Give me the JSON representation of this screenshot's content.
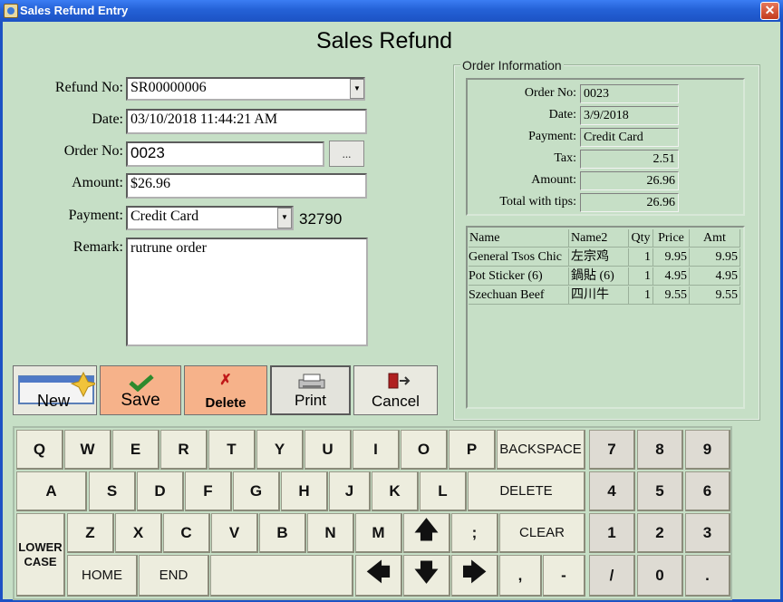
{
  "window": {
    "title": "Sales Refund Entry",
    "close_glyph": "✕"
  },
  "page_title": "Sales Refund",
  "form": {
    "refund_no_label": "Refund No:",
    "refund_no_value": "SR00000006",
    "date_label": "Date:",
    "date_value": "03/10/2018 11:44:21 AM",
    "order_no_label": "Order No:",
    "order_no_value": "0023",
    "order_lookup_label": "...",
    "amount_label": "Amount:",
    "amount_value": "$26.96",
    "payment_label": "Payment:",
    "payment_value": "Credit Card",
    "payment_code": "32790",
    "remark_label": "Remark:",
    "remark_value": "rutrune order",
    "dropdown_glyph": "▼"
  },
  "actions": {
    "new": "New",
    "save": "Save",
    "delete": "Delete",
    "delete_glyph": "✗",
    "print": "Print",
    "cancel": "Cancel"
  },
  "order_info": {
    "title": "Order Information",
    "order_no_label": "Order No:",
    "order_no": "0023",
    "date_label": "Date:",
    "date": "3/9/2018",
    "payment_label": "Payment:",
    "payment": "Credit Card",
    "tax_label": "Tax:",
    "tax": "2.51",
    "amount_label": "Amount:",
    "amount": "26.96",
    "total_label": "Total with tips:",
    "total": "26.96",
    "columns": {
      "name": "Name",
      "name2": "Name2",
      "qty": "Qty",
      "price": "Price",
      "amt": "Amt"
    },
    "items": [
      {
        "name": "General Tsos Chic",
        "name2": "左宗鸡",
        "qty": "1",
        "price": "9.95",
        "amt": "9.95"
      },
      {
        "name": "Pot Sticker (6)",
        "name2": "鍋貼 (6)",
        "qty": "1",
        "price": "4.95",
        "amt": "4.95"
      },
      {
        "name": "Szechuan Beef",
        "name2": "四川牛",
        "qty": "1",
        "price": "9.55",
        "amt": "9.55"
      }
    ]
  },
  "keyboard": {
    "row1": [
      "Q",
      "W",
      "E",
      "R",
      "T",
      "Y",
      "U",
      "I",
      "O",
      "P"
    ],
    "backspace": "BACKSPACE",
    "row2": [
      "A",
      "S",
      "D",
      "F",
      "G",
      "H",
      "J",
      "K",
      "L"
    ],
    "delete": "DELETE",
    "lower_case_1": "LOWER",
    "lower_case_2": "CASE",
    "row3": [
      "Z",
      "X",
      "C",
      "V",
      "B",
      "N",
      "M"
    ],
    "up": "🡅",
    "semicolon": ";",
    "clear": "CLEAR",
    "home": "HOME",
    "end": "END",
    "space": "",
    "left": "🡄",
    "down": "🡇",
    "right": "🡆",
    "comma": ",",
    "dash": "-",
    "numpad": [
      "7",
      "8",
      "9",
      "4",
      "5",
      "6",
      "1",
      "2",
      "3",
      "/",
      "0",
      "."
    ]
  }
}
